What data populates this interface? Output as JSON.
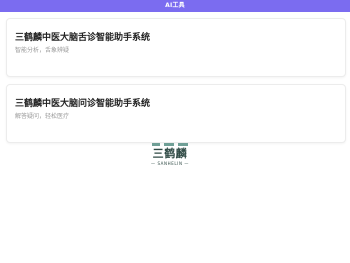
{
  "topbar": {
    "title": "AI工具",
    "color": "#7b6cf0"
  },
  "cards": [
    {
      "title": "三鹤麟中医大脑舌诊智能助手系统",
      "subtitle": "智能分析，舌象辨疑"
    },
    {
      "title": "三鹤麟中医大脑问诊智能助手系统",
      "subtitle": "解答疑问，轻松医疗"
    }
  ],
  "logo": {
    "text": "三鹤麟",
    "subtext": "— SANHELIN —",
    "color": "#2f4a45"
  }
}
